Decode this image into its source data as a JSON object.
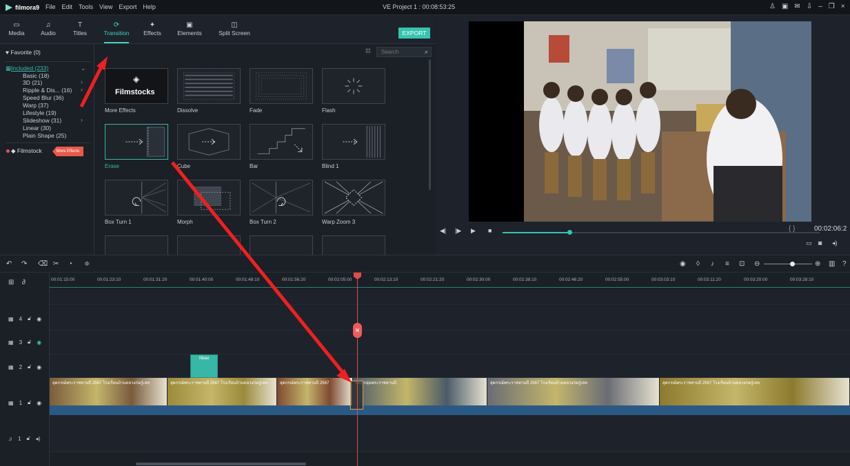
{
  "app": {
    "name": "filmora9",
    "menu": [
      "File",
      "Edit",
      "Tools",
      "View",
      "Export",
      "Help"
    ],
    "project_title": "VE Project 1 : 00:08:53:25",
    "window_controls": [
      "account-icon",
      "save-icon",
      "mail-icon",
      "download-icon",
      "minimize-icon",
      "maximize-icon",
      "close-icon"
    ]
  },
  "tabs": [
    {
      "label": "Media",
      "icon": "folder-icon",
      "glyph": "▭"
    },
    {
      "label": "Audio",
      "icon": "music-icon",
      "glyph": "♫"
    },
    {
      "label": "Titles",
      "icon": "text-icon",
      "glyph": "T"
    },
    {
      "label": "Transition",
      "icon": "transition-icon",
      "glyph": "⟳"
    },
    {
      "label": "Effects",
      "icon": "effects-icon",
      "glyph": "✦"
    },
    {
      "label": "Elements",
      "icon": "elements-icon",
      "glyph": "▣"
    },
    {
      "label": "Split Screen",
      "icon": "split-screen-icon",
      "glyph": "◫"
    }
  ],
  "active_tab": "Transition",
  "export_label": "EXPORT",
  "categories": {
    "favorite": "Favorite (0)",
    "included": "Included (233)",
    "items": [
      "Basic (18)",
      "3D (21)",
      "Ripple & Dis... (16)",
      "Speed Blur (36)",
      "Warp (37)",
      "Lifestyle (19)",
      "Slideshow (31)",
      "Linear (30)",
      "Plain Shape (25)"
    ],
    "filmstock": "Filmstock",
    "more_effects_tag": "More Effects"
  },
  "search": {
    "placeholder": "Search"
  },
  "effects": [
    {
      "label": "More Effects",
      "brand": "Filmstocks"
    },
    {
      "label": "Dissolve"
    },
    {
      "label": "Fade"
    },
    {
      "label": "Flash"
    },
    {
      "label": "Erase",
      "selected": true
    },
    {
      "label": "Cube"
    },
    {
      "label": "Bar"
    },
    {
      "label": "Blind 1"
    },
    {
      "label": "Box Turn 1"
    },
    {
      "label": "Morph"
    },
    {
      "label": "Box Turn 2"
    },
    {
      "label": "Warp Zoom 3"
    }
  ],
  "preview": {
    "timecode": "00:02:06:2",
    "progress_fraction": 0.21,
    "brace": "{ }"
  },
  "ruler_ticks": [
    "00:01:15:00",
    "00:01:23:10",
    "00:01:31:20",
    "00:01:40:00",
    "00:01:48:10",
    "00:01:56:20",
    "00:02:05:00",
    "00:02:13:10",
    "00:02:21:20",
    "00:02:30:00",
    "00:02:38:10",
    "00:02:46:20",
    "00:02:55:00",
    "00:03:03:10",
    "00:03:11:20",
    "00:03:20:00",
    "00:03:28:10"
  ],
  "tracks": [
    {
      "label": "4"
    },
    {
      "label": "3"
    },
    {
      "label": "2"
    },
    {
      "label": "1"
    },
    {
      "label": "1",
      "audio": true
    }
  ],
  "title_clip_label": "Nbao",
  "video_clips": [
    {
      "label": "สุดกรณ์พระราชทานปี 2567 โรงเรียนบ้านหลวงก่อกู๋เลข",
      "color": "#7a5b3c"
    },
    {
      "label": "สุดกรณ์พระราชทานปี 2567 โรงเรียนบ้านหลวงก่อกู๋เลข",
      "color": "#9b8a3a"
    },
    {
      "label": "สุดกรณ์พระราชทานปี 2567",
      "color": "#7f4a32"
    },
    {
      "label": "ผมมีกลุ่มพระราชทานปี",
      "color": "#4b5a68"
    },
    {
      "label": "สุดกรณ์พระราชทานปี 2567 โรงเรียนบ้านหลวงก่อกู๋เลข",
      "color": "#6a6c74"
    },
    {
      "label": "สุดกรณ์พระราชทานปี 2567 โรงเรียนบ้านหลวงก่อกู๋เลข",
      "color": "#8c7a2e"
    }
  ],
  "colors": {
    "accent": "#36c4b1",
    "playhead": "#e24b4b",
    "arrow": "#ef2020"
  }
}
